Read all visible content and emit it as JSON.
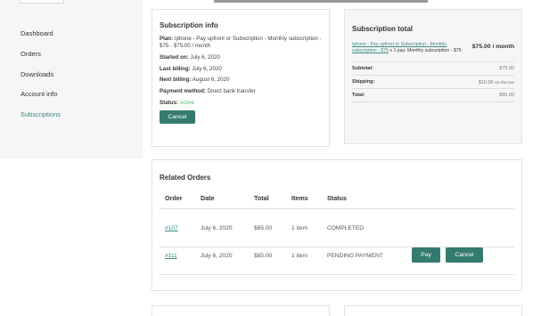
{
  "sidebar": {
    "items": [
      {
        "label": "Dashboard"
      },
      {
        "label": "Orders"
      },
      {
        "label": "Downloads"
      },
      {
        "label": "Account info"
      },
      {
        "label": "Subscriptions"
      }
    ],
    "active_index": 4
  },
  "subscription_info": {
    "title": "Subscription info",
    "plan_label": "Plan:",
    "plan_value": "Iphone - Pay upfront or Subscription - Monthly subscription - $75 - $75.00 / month",
    "started_label": "Started on:",
    "started_value": "July 6, 2020",
    "last_billing_label": "Last billing:",
    "last_billing_value": "July 6, 2020",
    "next_billing_label": "Next billing:",
    "next_billing_value": "August 6, 2020",
    "payment_label": "Payment method:",
    "payment_value": "Direct bank transfer",
    "status_label": "Status:",
    "status_value": "Active",
    "cancel_label": "Cancel"
  },
  "subscription_total": {
    "title": "Subscription total",
    "item_link": "Iphone - Pay upfront or Subscription - Monthly subscription - $75",
    "item_qty": "x 1 pay: Monthly subscription - $75",
    "item_price": "$75.00 / month",
    "subtotal_label": "Subtotal:",
    "subtotal_value": "$75.00",
    "shipping_label": "Shipping:",
    "shipping_value": "$10.00",
    "shipping_via": "via Flat rate",
    "total_label": "Total:",
    "total_value": "$85.00"
  },
  "related_orders": {
    "title": "Related Orders",
    "columns": {
      "order": "Order",
      "date": "Date",
      "total": "Total",
      "items": "Items",
      "status": "Status"
    },
    "rows": [
      {
        "order": "#107",
        "date": "July 6, 2020",
        "total": "$85.00",
        "items": "1 item",
        "status": "COMPLETED"
      },
      {
        "order": "#111",
        "date": "July 6, 2020",
        "total": "$85.00",
        "items": "1 item",
        "status": "PENDING PAYMENT",
        "pay_label": "Pay",
        "cancel_label": "Cancel"
      }
    ]
  },
  "colors": {
    "accent": "#357a6e",
    "link": "#3a8a80",
    "status_active": "#5fb76a",
    "sidebar_bg": "#f6f6f6"
  }
}
